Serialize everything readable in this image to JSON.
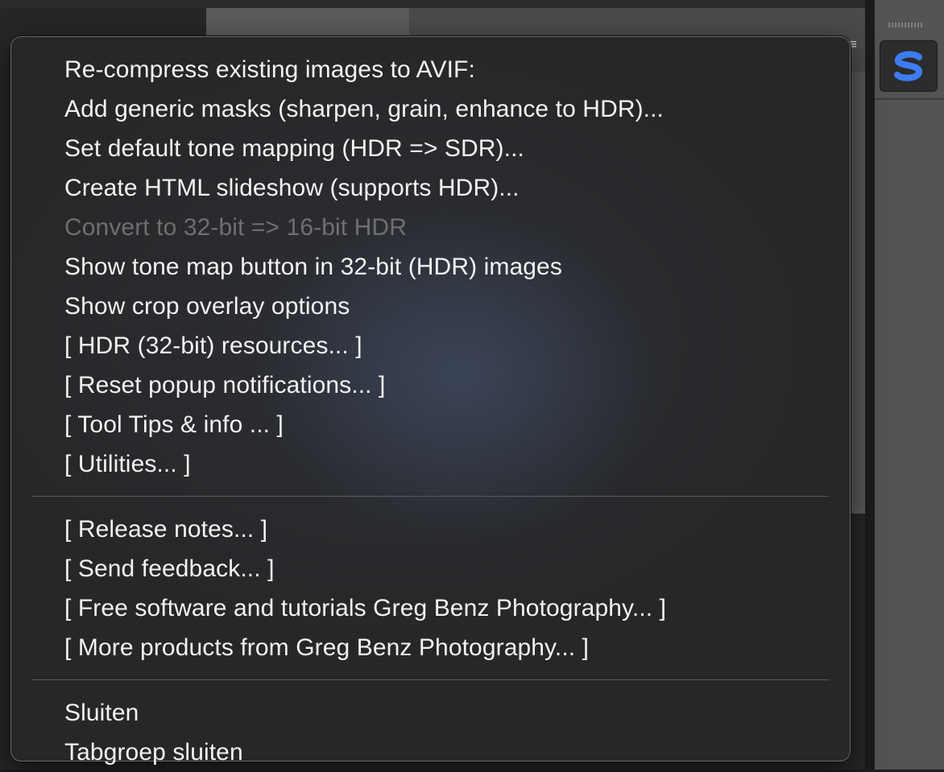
{
  "menu": {
    "group1": [
      {
        "label": "Re-compress existing images to AVIF:",
        "enabled": true
      },
      {
        "label": "Add generic masks (sharpen, grain, enhance to HDR)...",
        "enabled": true
      },
      {
        "label": "Set default tone mapping (HDR => SDR)...",
        "enabled": true
      },
      {
        "label": "Create HTML slideshow (supports HDR)...",
        "enabled": true
      },
      {
        "label": "Convert to 32-bit => 16-bit HDR",
        "enabled": false
      },
      {
        "label": "Show tone map button in 32-bit (HDR) images",
        "enabled": true
      },
      {
        "label": "Show crop overlay options",
        "enabled": true
      },
      {
        "label": "[ HDR (32-bit) resources... ]",
        "enabled": true
      },
      {
        "label": "[ Reset popup notifications... ]",
        "enabled": true
      },
      {
        "label": "[ Tool Tips & info ... ]",
        "enabled": true
      },
      {
        "label": "[ Utilities... ]",
        "enabled": true
      }
    ],
    "group2": [
      {
        "label": "[ Release notes... ]",
        "enabled": true
      },
      {
        "label": "[ Send feedback... ]",
        "enabled": true
      },
      {
        "label": "[ Free software and tutorials Greg Benz Photography... ]",
        "enabled": true
      },
      {
        "label": "[ More products from Greg Benz Photography... ]",
        "enabled": true
      }
    ],
    "group3": [
      {
        "label": "Sluiten",
        "enabled": true
      },
      {
        "label": "Tabgroep sluiten",
        "enabled": true
      }
    ]
  },
  "dock": {
    "plugin_icon": "s-logo-icon",
    "plugin_icon_color": "#3d7cf2"
  },
  "colors": {
    "menu_text": "#f2f2f2",
    "menu_text_disabled": "#6f6f6f",
    "menu_background": "#262728"
  }
}
